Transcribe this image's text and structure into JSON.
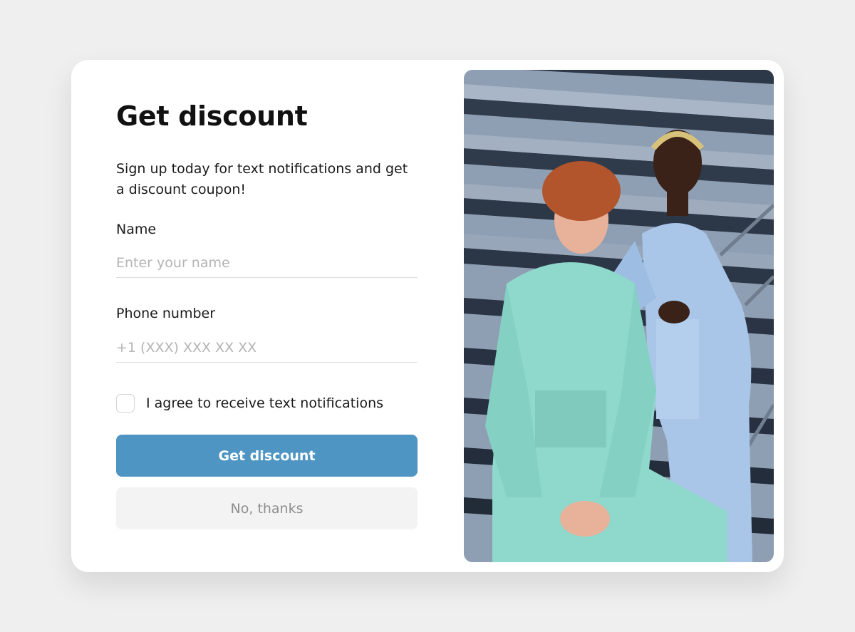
{
  "modal": {
    "title": "Get discount",
    "subtitle": "Sign up today for text notifications and get a discount coupon!",
    "name_field": {
      "label": "Name",
      "placeholder": "Enter your name",
      "value": ""
    },
    "phone_field": {
      "label": "Phone number",
      "placeholder": "+1 (XXX) XXX XX XX",
      "value": ""
    },
    "consent": {
      "label": "I agree to receive text notifications",
      "checked": false
    },
    "primary_button": "Get discount",
    "secondary_button": "No, thanks"
  },
  "colors": {
    "primary": "#4e95c4",
    "secondary_bg": "#f3f3f3",
    "background": "#efefef"
  }
}
